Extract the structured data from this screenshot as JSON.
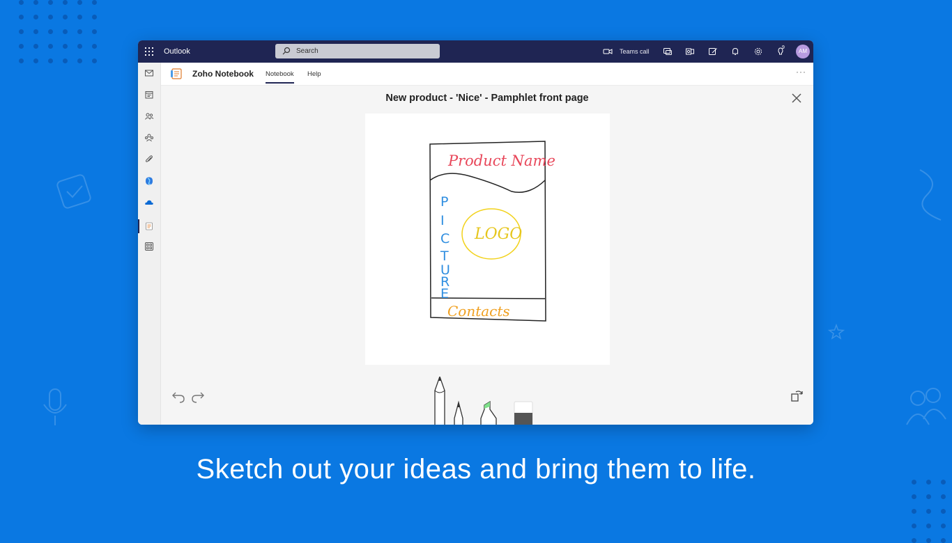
{
  "topbar": {
    "app_name": "Outlook",
    "search_placeholder": "Search",
    "teams_call_label": "Teams call",
    "notification_count": "9",
    "avatar_initials": "AM"
  },
  "app": {
    "title": "Zoho Notebook",
    "tabs": [
      {
        "label": "Notebook",
        "active": true
      },
      {
        "label": "Help",
        "active": false
      }
    ],
    "more_label": "···"
  },
  "note": {
    "title": "New product - 'Nice' - Pamphlet front page",
    "sketch_texts": {
      "product_name": "Product Name",
      "picture": [
        "P",
        "I",
        "C",
        "T",
        "U",
        "R",
        "E"
      ],
      "logo": "LOGO",
      "contacts": "Contacts"
    }
  },
  "tools": [
    "pencil",
    "pen",
    "highlighter",
    "eraser"
  ],
  "colors": {
    "accent_bg": "#0a78e2",
    "topbar": "#1f2553",
    "sketch_red": "#e8475a",
    "sketch_blue": "#2f8ee0",
    "sketch_yellow": "#f2d21c",
    "sketch_orange": "#f0a020",
    "highlighter_tip": "#7fe08a"
  },
  "caption": "Sketch out your ideas and bring them to life."
}
